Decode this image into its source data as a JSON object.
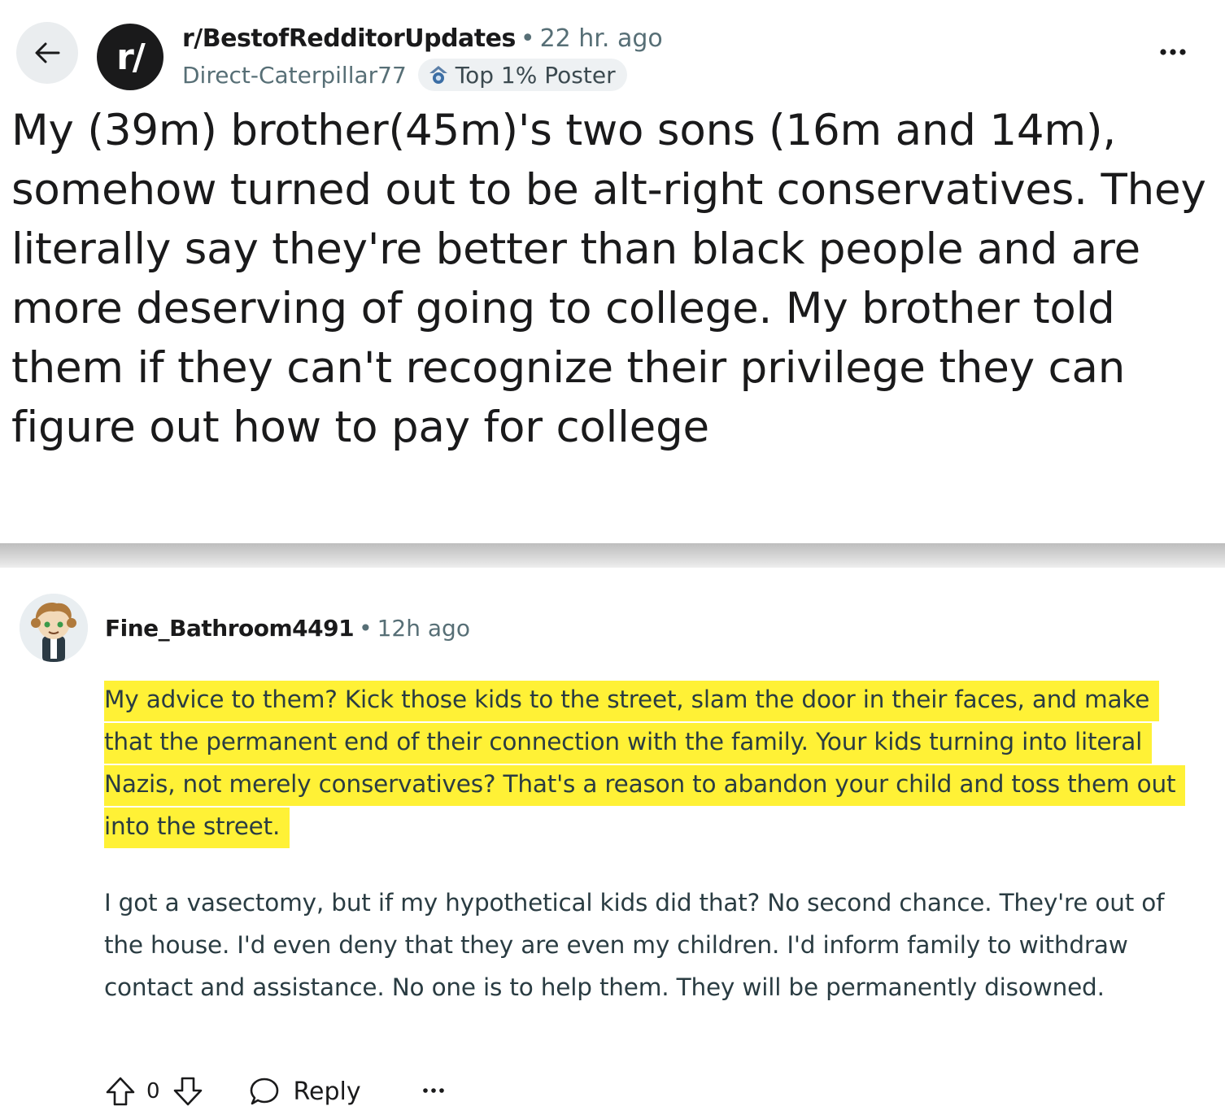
{
  "post": {
    "subreddit": "r/BestofRedditorUpdates",
    "subreddit_avatar_text": "r/",
    "separator": "•",
    "time": "22 hr. ago",
    "author": "Direct-Caterpillar77",
    "flair": "Top 1% Poster",
    "title": "My (39m) brother(45m)'s two sons (16m and 14m), somehow turned out to be alt-right conservatives. They literally say they're better than black people and are more deserving of going to college. My brother told them if they can't recognize their privilege they can figure out how to pay for college"
  },
  "comment": {
    "author": "Fine_Bathroom4491",
    "separator": "•",
    "time": "12h ago",
    "highlighted_paragraph": "My advice to them? Kick those kids to the street, slam the door in their faces, and make that the permanent end of their connection with the family. Your kids turning into literal Nazis, not merely conservatives? That's a reason to abandon your child and toss them out into the street.",
    "paragraph": "I got a vasectomy, but if my hypothetical kids did that? No second chance. They're out of the house. I'd even deny that they are even my children. I'd inform family to withdraw contact and assistance. No one is to help them. They will be permanently disowned.",
    "vote_count": "0",
    "reply_label": "Reply"
  },
  "colors": {
    "highlight": "#fff136",
    "meta_gray": "#576f76",
    "text": "#1a1a1b"
  }
}
